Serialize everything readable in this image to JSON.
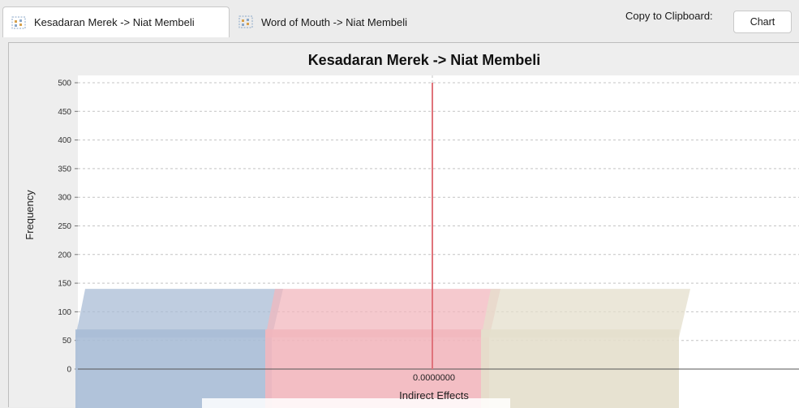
{
  "tabs": [
    {
      "label": "Kesadaran Merek -> Niat Membeli",
      "active": true
    },
    {
      "label": "Word of Mouth -> Niat Membeli",
      "active": false
    }
  ],
  "toolbar": {
    "copy_label": "Copy to Clipboard:",
    "chart_button": "Chart"
  },
  "chart_data": {
    "type": "bar",
    "title": "Kesadaran Merek -> Niat Membeli",
    "xlabel": "Indirect Effects",
    "ylabel": "Frequency",
    "ylim": [
      0,
      520
    ],
    "yticks": [
      0,
      50,
      100,
      150,
      200,
      250,
      300,
      350,
      400,
      450,
      500
    ],
    "x_tick_label": "0.0000000",
    "reference_line": {
      "x": 0,
      "height": 500,
      "color": "#e0737b"
    },
    "grid": true,
    "bars": [
      {
        "value": 140,
        "color": "#a9bcd6"
      },
      {
        "value": 140,
        "color": "#f2b7be"
      },
      {
        "value": 140,
        "color": "#e4dfcc"
      }
    ]
  }
}
